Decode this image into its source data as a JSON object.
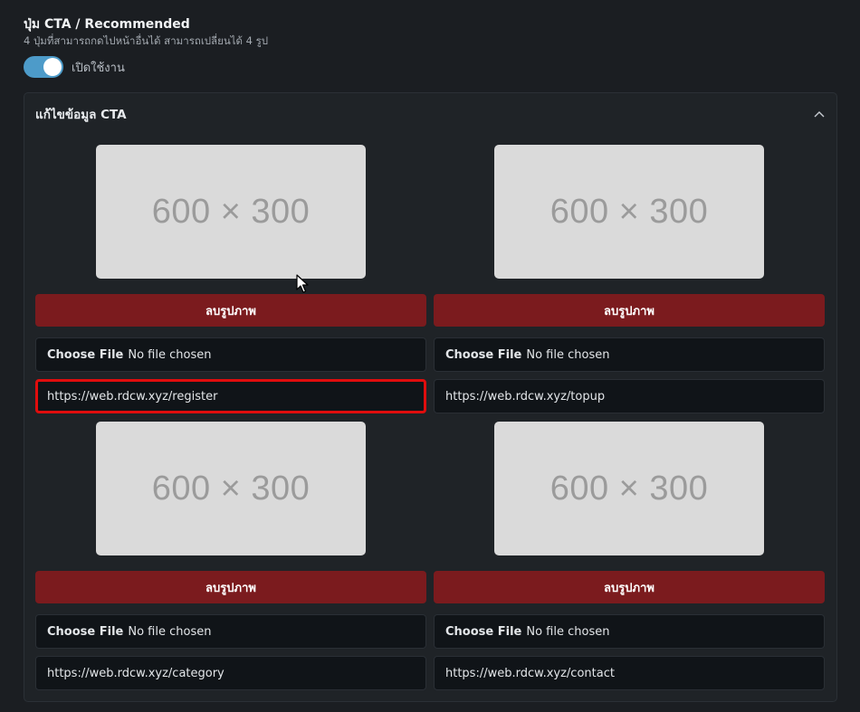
{
  "section": {
    "title": "ปุ่ม CTA / Recommended",
    "subtitle": "4 ปุ่มที่สามารถกดไปหน้าอื่นได้ สามารถเปลี่ยนได้ 4 รูป",
    "toggle_label": "เปิดใช้งาน",
    "toggle_on": true
  },
  "panel": {
    "title": "แก้ไขข้อมูล CTA",
    "collapse_icon": "chevron-up-icon"
  },
  "cards": [
    {
      "image_placeholder": "600 × 300",
      "delete_label": "ลบรูปภาพ",
      "file_button": "Choose File",
      "file_status": "No file chosen",
      "url": "https://web.rdcw.xyz/register",
      "highlighted": true
    },
    {
      "image_placeholder": "600 × 300",
      "delete_label": "ลบรูปภาพ",
      "file_button": "Choose File",
      "file_status": "No file chosen",
      "url": "https://web.rdcw.xyz/topup",
      "highlighted": false
    },
    {
      "image_placeholder": "600 × 300",
      "delete_label": "ลบรูปภาพ",
      "file_button": "Choose File",
      "file_status": "No file chosen",
      "url": "https://web.rdcw.xyz/category",
      "highlighted": false
    },
    {
      "image_placeholder": "600 × 300",
      "delete_label": "ลบรูปภาพ",
      "file_button": "Choose File",
      "file_status": "No file chosen",
      "url": "https://web.rdcw.xyz/contact",
      "highlighted": false
    }
  ],
  "colors": {
    "background": "#1b1e22",
    "panel": "#1f2327",
    "toggle_on": "#4d9bc9",
    "delete_button": "#7b1b1e",
    "input_bg": "#101418",
    "highlight_border": "#e00d0d"
  }
}
